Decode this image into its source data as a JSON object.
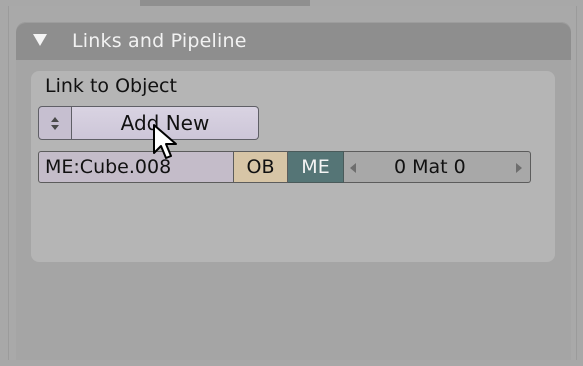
{
  "panel": {
    "title": "Links and Pipeline",
    "collapse_icon": "triangle-down"
  },
  "link_box": {
    "label": "Link to Object",
    "browse_icon": "up-down-arrows",
    "add_new_label": "Add New"
  },
  "datablock_row": {
    "mesh_name": "ME:Cube.008",
    "ob_label": "OB",
    "me_label": "ME",
    "material_text": "0 Mat 0",
    "me_color": "#557576",
    "ob_color": "#d7c5a6"
  },
  "cursor": {
    "icon": "arrow-pointer"
  }
}
